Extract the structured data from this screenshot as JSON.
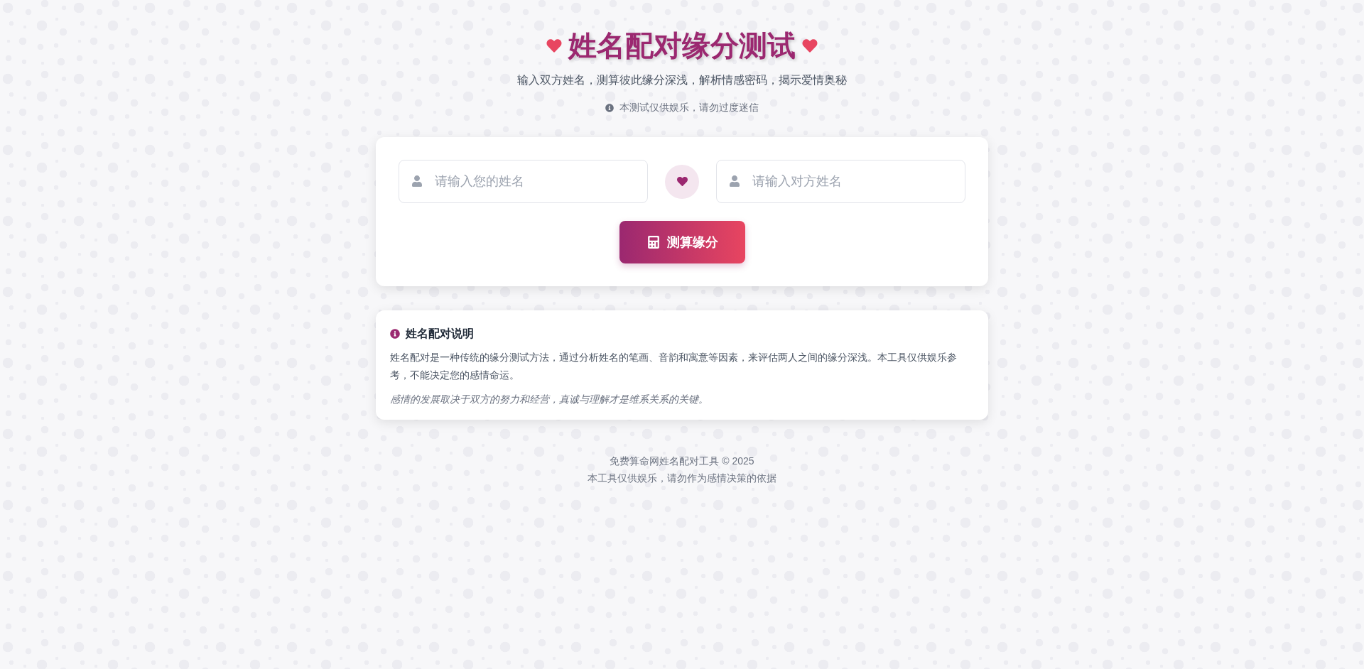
{
  "header": {
    "title": "姓名配对缘分测试",
    "subtitle": "输入双方姓名，测算彼此缘分深浅，解析情感密码，揭示爱情奥秘",
    "notice": "本测试仅供娱乐，请勿过度迷信"
  },
  "form": {
    "fields": [
      {
        "placeholder": "请输入您的姓名"
      },
      {
        "placeholder": "请输入对方姓名"
      }
    ],
    "submit_button": "测算缘分"
  },
  "info_card": {
    "title": "姓名配对说明",
    "paragraphs": [
      {
        "kind": "body",
        "text": "姓名配对是一种传统的缘分测试方法，通过分析姓名的笔画、音韵和寓意等因素，来评估两人之间的缘分深浅。本工具仅供娱乐参考，不能决定您的感情命运。"
      },
      {
        "kind": "quote",
        "text": "感情的发展取决于双方的努力和经营，真诚与理解才是维系关系的关键。"
      }
    ]
  },
  "footer": {
    "lines": [
      "免费算命网姓名配对工具 © 2025",
      "本工具仅供娱乐，请勿作为感情决策的依据"
    ]
  }
}
